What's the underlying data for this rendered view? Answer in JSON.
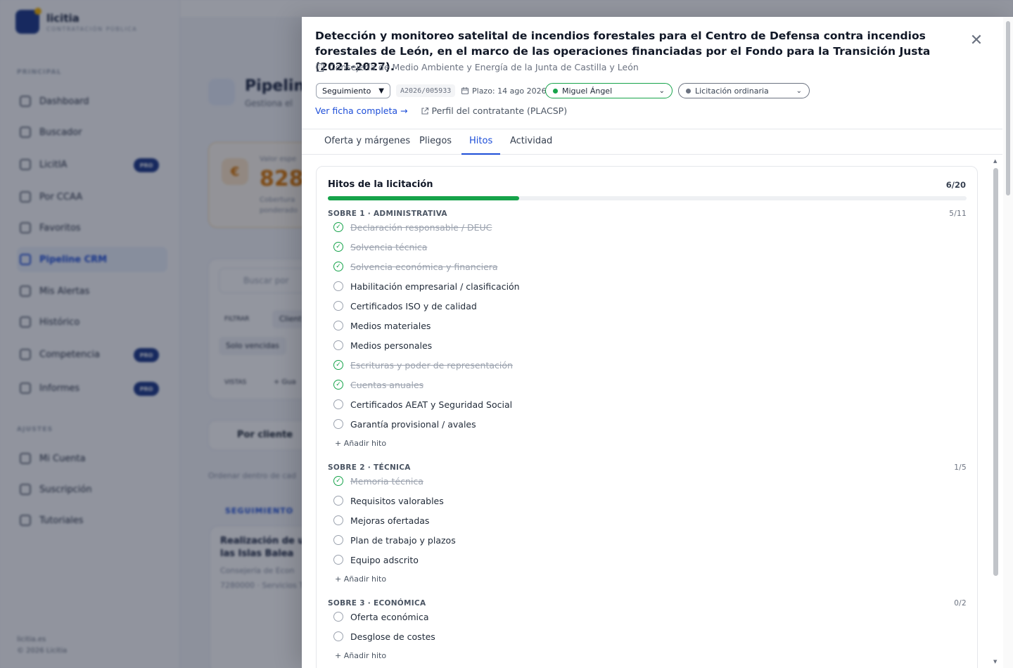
{
  "bg": {
    "brand_name": "licitia",
    "brand_sub": "CONTRATACIÓN PÚBLICA",
    "section_main": "PRINCIPAL",
    "nav": [
      "Dashboard",
      "Buscador",
      "LicitIA",
      "Por CCAA",
      "Favoritos",
      "Pipeline CRM",
      "Mis Alertas",
      "Histórico",
      "Competencia",
      "Informes"
    ],
    "pro_badge": "PRO",
    "section_settings": "AJUSTES",
    "nav_settings": [
      "Mi Cuenta",
      "Suscripción",
      "Tutoriales"
    ],
    "footer_1": "licitia.es",
    "footer_2": "© 2026 Licitia",
    "page_title": "Pipeline",
    "page_sub": "Gestiona el",
    "value_label": "Valor espe",
    "value_num": "828.",
    "value_sub_1": "Cobertura",
    "value_sub_2": "ponderado",
    "search_ph": "Buscar por",
    "filters_label": "FILTRAR",
    "chip_client": "Client",
    "chip_only_expired": "Solo vencidas",
    "views_label": "VISTAS",
    "views_add": "+ Gua",
    "group_label": "Por cliente",
    "order_label": "Ordenar dentro de cad",
    "seg_label": "SEGUIMIENTO",
    "card_title": "Realización de un de las Islas Balea",
    "card_org": "Consejería de Econ",
    "card_meta": "7280000 · Servicios Ti"
  },
  "drawer": {
    "title": "Detección y monitoreo satelital de incendios forestales para el Centro de Defensa contra incendios forestales de León, en el marco de las operaciones financiadas por el Fondo para la Transición Justa (2021-2027).",
    "organization": "Consejería de Medio Ambiente y Energía de la Junta de Castilla y León",
    "status_select": "Seguimiento",
    "code": "A2026/005933",
    "deadline": "Plazo: 14 ago 2026",
    "assignee": "Miguel Ángel",
    "procedure": "Licitación ordinaria",
    "link_full": "Ver ficha completa →",
    "link_profile": "Perfil del contratante (PLACSP)",
    "colors": {
      "accent": "#1d4ed8",
      "done": "#16a34a",
      "assignee_border": "#16a34a",
      "procedure_dot": "#6b7280"
    },
    "tabs": [
      "Oferta y márgenes",
      "Pliegos",
      "Hitos",
      "Actividad"
    ],
    "active_tab": "Hitos"
  },
  "milestones": {
    "title": "Hitos de la licitación",
    "count": "6/20",
    "progress_fraction": 0.3,
    "add_label": "Añadir hito",
    "sections": [
      {
        "name": "SOBRE 1 · ADMINISTRATIVA",
        "count": "5/11",
        "items": [
          {
            "label": "Declaración responsable / DEUC",
            "done": true
          },
          {
            "label": "Solvencia técnica",
            "done": true
          },
          {
            "label": "Solvencia económica y financiera",
            "done": true
          },
          {
            "label": "Habilitación empresarial / clasificación",
            "done": false
          },
          {
            "label": "Certificados ISO y de calidad",
            "done": false
          },
          {
            "label": "Medios materiales",
            "done": false
          },
          {
            "label": "Medios personales",
            "done": false
          },
          {
            "label": "Escrituras y poder de representación",
            "done": true
          },
          {
            "label": "Cuentas anuales",
            "done": true
          },
          {
            "label": "Certificados AEAT y Seguridad Social",
            "done": false
          },
          {
            "label": "Garantía provisional / avales",
            "done": false
          }
        ]
      },
      {
        "name": "SOBRE 2 · TÉCNICA",
        "count": "1/5",
        "items": [
          {
            "label": "Memoria técnica",
            "done": true
          },
          {
            "label": "Requisitos valorables",
            "done": false
          },
          {
            "label": "Mejoras ofertadas",
            "done": false
          },
          {
            "label": "Plan de trabajo y plazos",
            "done": false
          },
          {
            "label": "Equipo adscrito",
            "done": false
          }
        ]
      },
      {
        "name": "SOBRE 3 · ECONÓMICA",
        "count": "0/2",
        "items": [
          {
            "label": "Oferta económica",
            "done": false
          },
          {
            "label": "Desglose de costes",
            "done": false
          }
        ]
      }
    ]
  }
}
